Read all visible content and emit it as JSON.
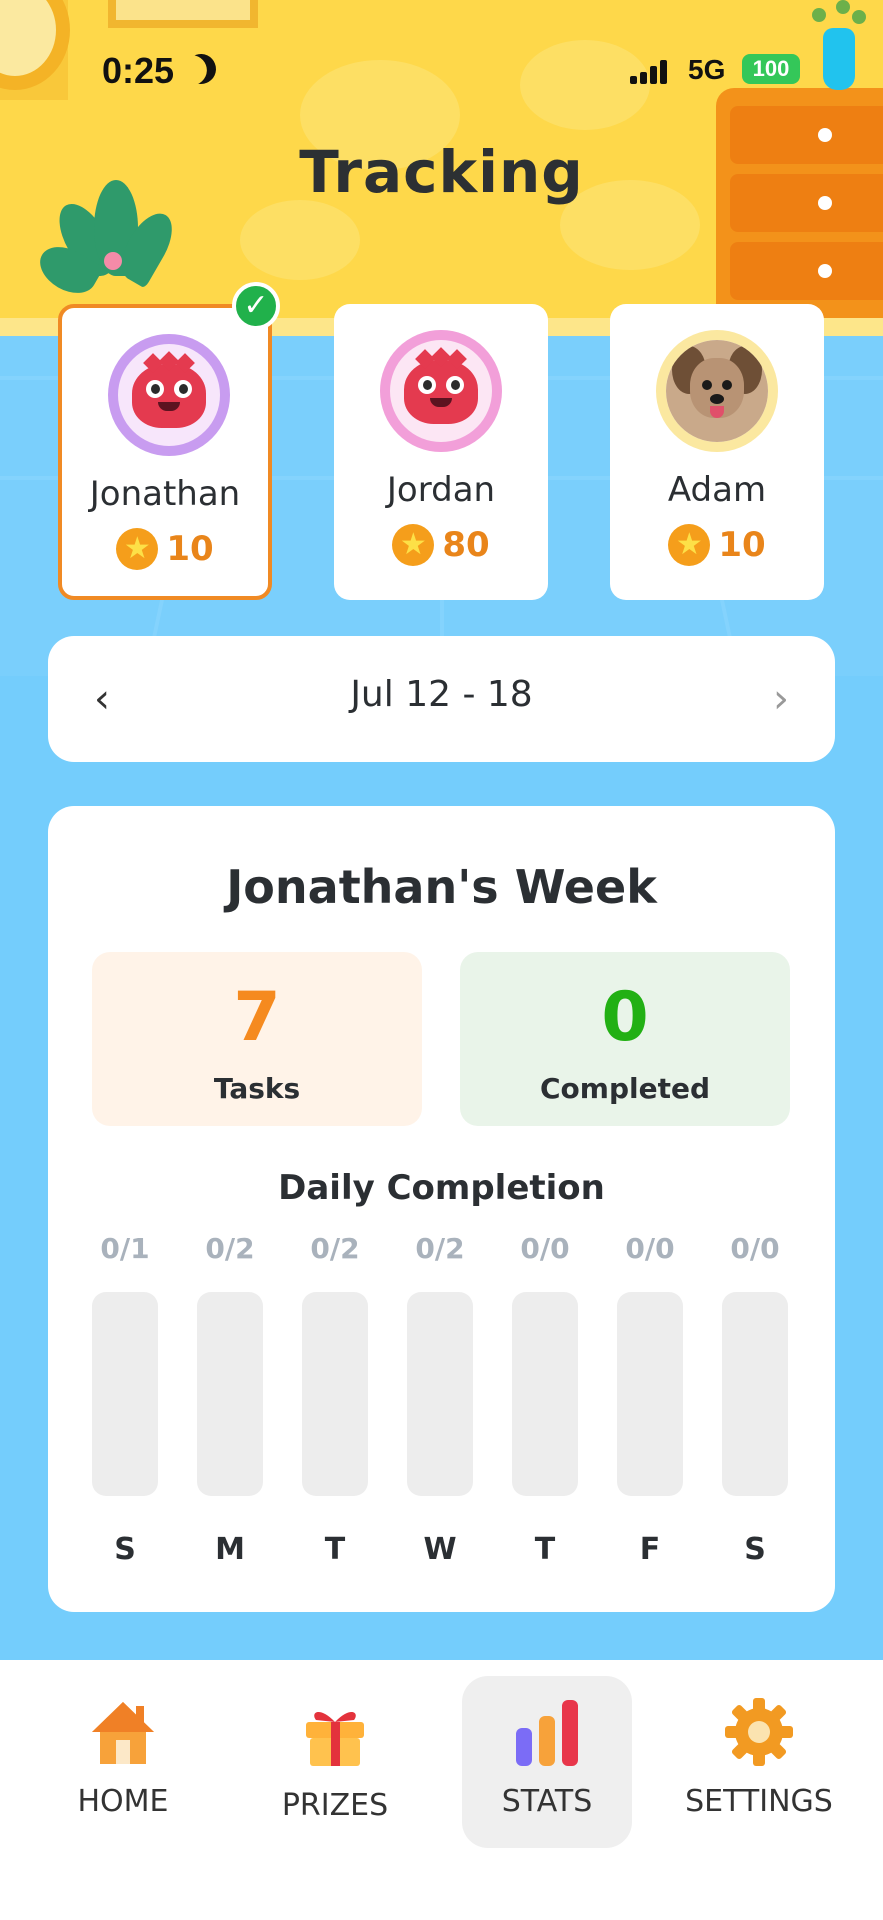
{
  "status_bar": {
    "time": "0:25",
    "network": "5G",
    "battery": "100"
  },
  "header": {
    "title": "Tracking"
  },
  "kids": [
    {
      "name": "Jonathan",
      "points": "10",
      "avatar": "red-monster",
      "selected": true
    },
    {
      "name": "Jordan",
      "points": "80",
      "avatar": "red-monster",
      "selected": false
    },
    {
      "name": "Adam",
      "points": "10",
      "avatar": "dog-photo",
      "selected": false
    }
  ],
  "week_nav": {
    "label": "Jul 12 - 18",
    "prev_icon": "chevron-left-icon",
    "next_icon": "chevron-right-icon"
  },
  "summary": {
    "title": "Jonathan's Week",
    "tasks": {
      "value": "7",
      "label": "Tasks",
      "color": "#F58A1F"
    },
    "completed": {
      "value": "0",
      "label": "Completed",
      "color": "#22B014"
    }
  },
  "daily": {
    "title": "Daily Completion",
    "days": [
      {
        "letter": "S",
        "ratio": "0/1",
        "fraction": 0
      },
      {
        "letter": "M",
        "ratio": "0/2",
        "fraction": 0
      },
      {
        "letter": "T",
        "ratio": "0/2",
        "fraction": 0
      },
      {
        "letter": "W",
        "ratio": "0/2",
        "fraction": 0
      },
      {
        "letter": "T",
        "ratio": "0/0",
        "fraction": 0
      },
      {
        "letter": "F",
        "ratio": "0/0",
        "fraction": 0
      },
      {
        "letter": "S",
        "ratio": "0/0",
        "fraction": 0
      }
    ]
  },
  "tabs": [
    {
      "label": "HOME",
      "icon": "house-icon",
      "active": false
    },
    {
      "label": "PRIZES",
      "icon": "gift-icon",
      "active": false
    },
    {
      "label": "STATS",
      "icon": "bar-chart-icon",
      "active": true
    },
    {
      "label": "SETTINGS",
      "icon": "gear-icon",
      "active": false
    }
  ],
  "colors": {
    "accent_orange": "#F08A24",
    "check_green": "#21B14B",
    "background_blue": "#74CDFC",
    "wall_yellow": "#FED84A"
  }
}
